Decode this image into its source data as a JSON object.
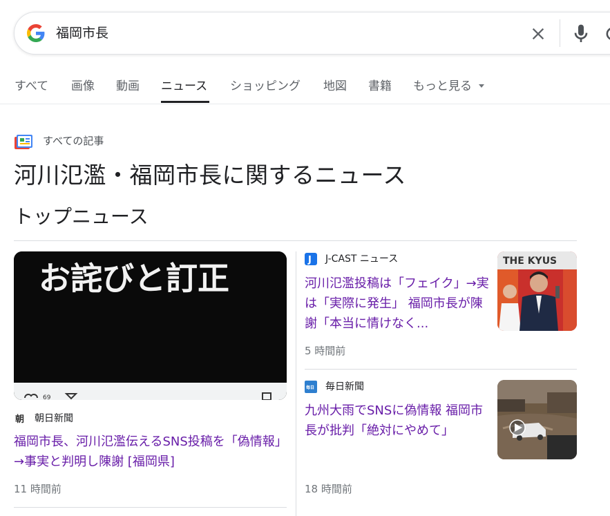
{
  "search": {
    "query": "福岡市長"
  },
  "tabs": [
    {
      "label": "すべて"
    },
    {
      "label": "画像"
    },
    {
      "label": "動画"
    },
    {
      "label": "ニュース",
      "active": true
    },
    {
      "label": "ショッピング"
    },
    {
      "label": "地図"
    },
    {
      "label": "書籍"
    },
    {
      "label": "もっと見る"
    }
  ],
  "header": {
    "all_articles_label": "すべての記事",
    "page_title": "河川氾濫・福岡市長に関するニュース",
    "section_title": "トップニュース"
  },
  "articles": [
    {
      "source": "朝日新聞",
      "source_icon_text": "朝",
      "headline": "福岡市長、河川氾濫伝えるSNS投稿を「偽情報」→事実と判明し陳謝 [福岡県]",
      "time": "11 時間前",
      "thumbnail_text": "お詫びと訂正"
    },
    {
      "source": "J-CAST ニュース",
      "source_icon_text": "J",
      "headline": "河川氾濫投稿は「フェイク」→実は「実際に発生」 福岡市長が陳謝「本当に情けなく...",
      "time": "5 時間前",
      "thumbnail_text": "THE KYUS"
    },
    {
      "source": "毎日新聞",
      "source_icon_text": "毎日",
      "headline": "九州大雨でSNSに偽情報 福岡市長が批判「絶対にやめて」",
      "time": "18 時間前"
    }
  ],
  "colors": {
    "visited_link": "#681da8",
    "meta_text": "#70757a",
    "divider": "#dadce0"
  }
}
